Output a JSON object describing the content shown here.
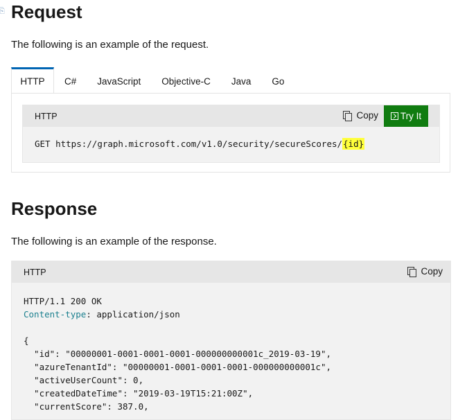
{
  "request": {
    "title": "Request",
    "description": "The following is an example of the request.",
    "tabs": [
      "HTTP",
      "C#",
      "JavaScript",
      "Objective-C",
      "Java",
      "Go"
    ],
    "active_tab": "HTTP",
    "code_lang": "HTTP",
    "copy_label": "Copy",
    "tryit_label": "Try It",
    "method": "GET",
    "url": "https://graph.microsoft.com/v1.0/security/secureScores/",
    "url_param": "{id}"
  },
  "response": {
    "title": "Response",
    "description": "The following is an example of the response.",
    "code_lang": "HTTP",
    "copy_label": "Copy",
    "status_line": "HTTP/1.1 200 OK",
    "content_type_key": "Content-type",
    "content_type_value": ": application/json",
    "body_lines": [
      "{",
      "  \"id\": \"00000001-0001-0001-0001-000000000001c_2019-03-19\",",
      "  \"azureTenantId\": \"00000001-0001-0001-0001-000000000001c\",",
      "  \"activeUserCount\": 0,",
      "  \"createdDateTime\": \"2019-03-19T15:21:00Z\",",
      "  \"currentScore\": 387.0,"
    ]
  }
}
